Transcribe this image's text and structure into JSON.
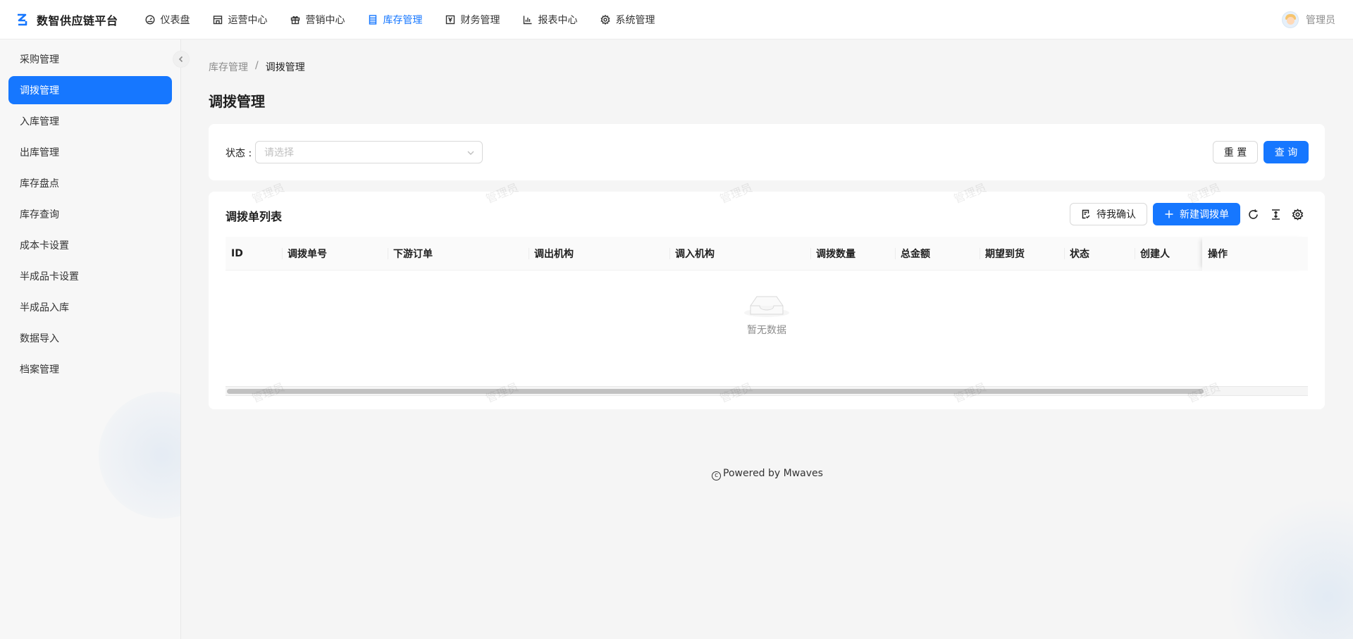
{
  "app": {
    "title": "数智供应链平台"
  },
  "nav": {
    "items": [
      {
        "label": "仪表盘",
        "icon": "dashboard-icon"
      },
      {
        "label": "运营中心",
        "icon": "store-icon"
      },
      {
        "label": "营销中心",
        "icon": "gift-icon"
      },
      {
        "label": "库存管理",
        "icon": "inventory-icon",
        "active": true
      },
      {
        "label": "财务管理",
        "icon": "finance-icon"
      },
      {
        "label": "报表中心",
        "icon": "bar-chart-icon"
      },
      {
        "label": "系统管理",
        "icon": "gear-icon"
      }
    ]
  },
  "user": {
    "name": "管理员"
  },
  "sidebar": {
    "items": [
      {
        "label": "采购管理"
      },
      {
        "label": "调拨管理",
        "active": true
      },
      {
        "label": "入库管理"
      },
      {
        "label": "出库管理"
      },
      {
        "label": "库存盘点"
      },
      {
        "label": "库存查询"
      },
      {
        "label": "成本卡设置"
      },
      {
        "label": "半成品卡设置"
      },
      {
        "label": "半成品入库"
      },
      {
        "label": "数据导入"
      },
      {
        "label": "档案管理"
      }
    ]
  },
  "breadcrumb": {
    "parent": "库存管理",
    "separator": "/",
    "current": "调拨管理"
  },
  "page": {
    "title": "调拨管理"
  },
  "filter": {
    "status_label": "状态 :",
    "status_placeholder": "请选择",
    "reset_label": "重 置",
    "query_label": "查 询"
  },
  "table": {
    "title": "调拨单列表",
    "pending_label": "待我确认",
    "new_label": "新建调拨单",
    "columns": [
      "ID",
      "调拨单号",
      "下游订单",
      "调出机构",
      "调入机构",
      "调拨数量",
      "总金额",
      "期望到货",
      "状态",
      "创建人",
      "操作"
    ],
    "empty_text": "暂无数据"
  },
  "watermark": {
    "text": "管理员"
  },
  "footer": {
    "text": "Powered by Mwaves",
    "copyright_symbol": "c"
  },
  "colors": {
    "primary": "#1677ff",
    "background": "#f5f5f5"
  }
}
